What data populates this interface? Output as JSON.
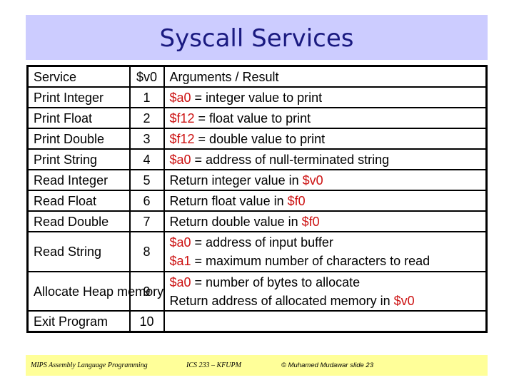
{
  "slide": {
    "title": "Syscall Services",
    "colors": {
      "title_band": "#ccccff",
      "title_text": "#1a1a80",
      "register_highlight": "#cc1111",
      "footer_band": "#ffff99"
    }
  },
  "table": {
    "headers": {
      "service": "Service",
      "v0": "$v0",
      "args": "Arguments / Result"
    },
    "rows": [
      {
        "service": "Print Integer",
        "service_color": "red",
        "code": "1",
        "args": [
          [
            {
              "t": "$a0",
              "reg": true
            },
            {
              "t": " = integer value to print"
            }
          ]
        ]
      },
      {
        "service": "Print Float",
        "service_color": "black",
        "code": "2",
        "args": [
          [
            {
              "t": "$f12",
              "reg": true
            },
            {
              "t": " =  float value to print"
            }
          ]
        ]
      },
      {
        "service": "Print Double",
        "service_color": "black",
        "code": "3",
        "args": [
          [
            {
              "t": "$f12",
              "reg": true
            },
            {
              "t": " = double value to print"
            }
          ]
        ]
      },
      {
        "service": "Print String",
        "service_color": "navy",
        "code": "4",
        "args": [
          [
            {
              "t": "$a0",
              "reg": true
            },
            {
              "t": " = address of null-terminated string"
            }
          ]
        ]
      },
      {
        "service": "Read Integer",
        "service_color": "red",
        "code": "5",
        "args": [
          [
            {
              "t": "Return integer value in "
            },
            {
              "t": "$v0",
              "reg": true
            }
          ]
        ]
      },
      {
        "service": "Read Float",
        "service_color": "black",
        "code": "6",
        "args": [
          [
            {
              "t": "Return float value in "
            },
            {
              "t": "$f0",
              "reg": true
            }
          ]
        ]
      },
      {
        "service": "Read Double",
        "service_color": "black",
        "code": "7",
        "args": [
          [
            {
              "t": "Return double value in "
            },
            {
              "t": "$f0",
              "reg": true
            }
          ]
        ]
      },
      {
        "service": "Read String",
        "service_color": "navy",
        "code": "8",
        "args": [
          [
            {
              "t": "$a0",
              "reg": true
            },
            {
              "t": " = address of input buffer"
            }
          ],
          [
            {
              "t": "$a1",
              "reg": true
            },
            {
              "t": " = maximum number of characters to read"
            }
          ]
        ]
      },
      {
        "service": "Allocate Heap memory",
        "service_color": "teal",
        "code": "9",
        "args": [
          [
            {
              "t": "$a0",
              "reg": true
            },
            {
              "t": " = number of bytes to allocate"
            }
          ],
          [
            {
              "t": "Return address of allocated memory in "
            },
            {
              "t": "$v0",
              "reg": true
            }
          ]
        ]
      },
      {
        "service": "Exit Program",
        "service_color": "darkred",
        "code": "10",
        "args": []
      }
    ]
  },
  "footer": {
    "course": "MIPS Assembly Language Programming",
    "institution": "ICS 233 – KFUPM",
    "author_slide": "© Muhamed Mudawar   slide 23"
  }
}
